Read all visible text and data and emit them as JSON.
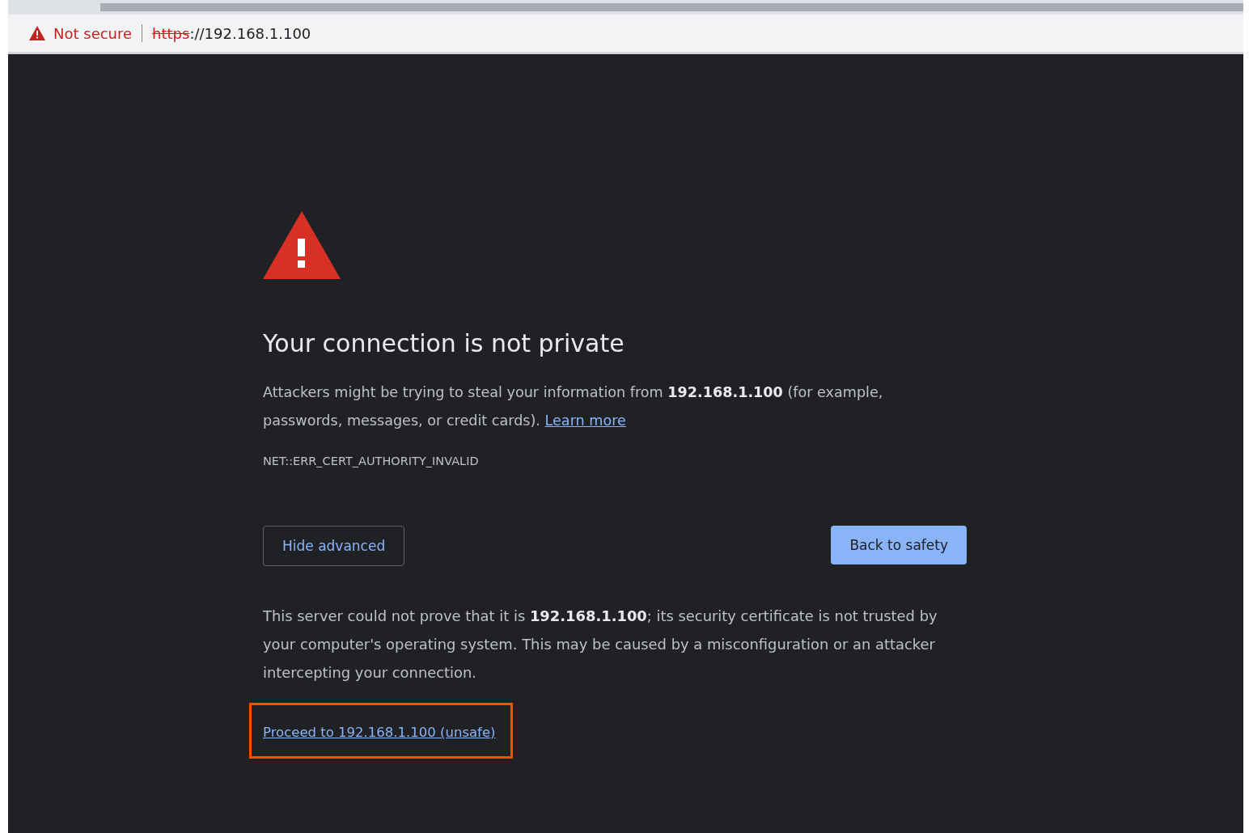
{
  "address_bar": {
    "security_label": "Not secure",
    "scheme": "https",
    "rest": "://192.168.1.100"
  },
  "error_page": {
    "title": "Your connection is not private",
    "intro": "Attackers might be trying to steal your information from **192.168.1.100** (for example, passwords, messages, or credit cards).",
    "learn_more": "Learn more",
    "error_code": "NET::ERR_CERT_AUTHORITY_INVALID",
    "buttons": [
      {
        "label": "Hide advanced",
        "kind": "secondary"
      },
      {
        "label": "Back to safety",
        "kind": "primary"
      }
    ],
    "details": "This server could not prove that it is **192.168.1.100**; its security certificate is not trusted by your computer's operating system. This may be caused by a misconfiguration or an attacker intercepting your connection.",
    "proceed_link": {
      "label": "Proceed to 192.168.1.100 (unsafe)",
      "highlighted": true
    }
  }
}
